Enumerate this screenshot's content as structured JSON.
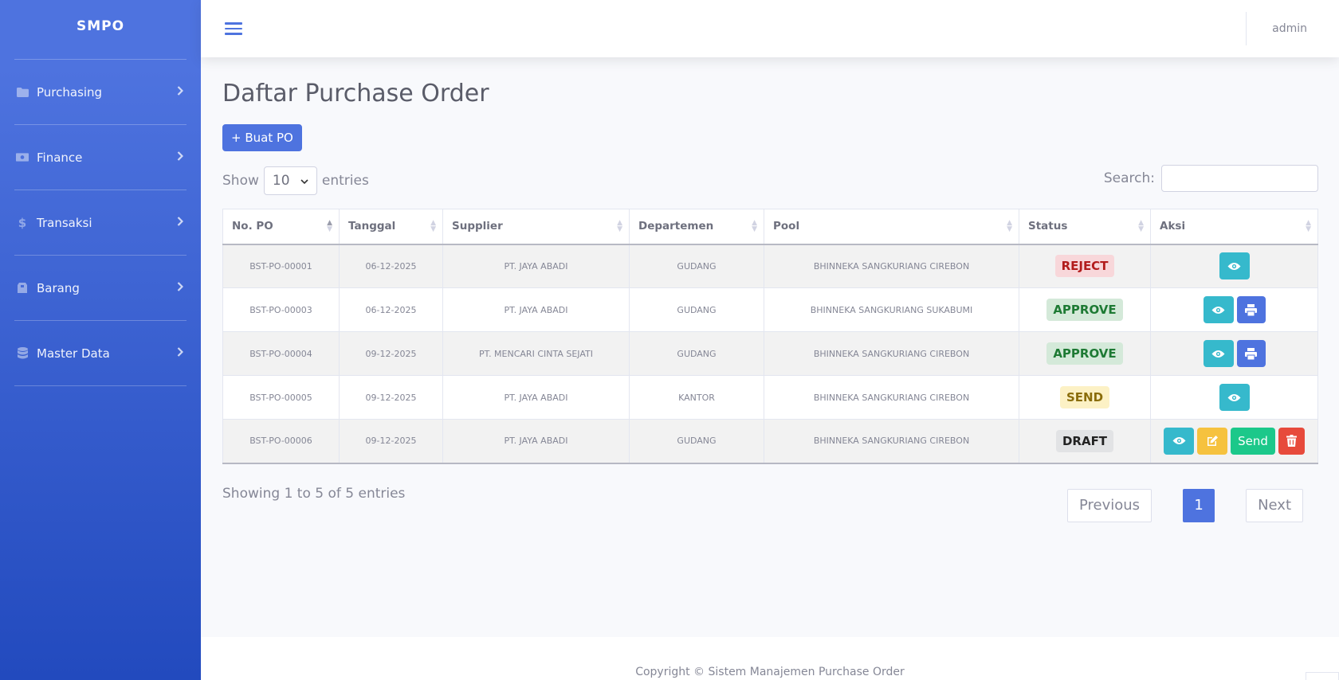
{
  "brand": "SMPO",
  "sidebar": {
    "items": [
      {
        "label": "Purchasing",
        "icon": "folder-icon"
      },
      {
        "label": "Finance",
        "icon": "money-bill-icon"
      },
      {
        "label": "Transaksi",
        "icon": "dollar-icon"
      },
      {
        "label": "Barang",
        "icon": "box-icon"
      },
      {
        "label": "Master Data",
        "icon": "database-icon"
      }
    ]
  },
  "topbar": {
    "user": "admin"
  },
  "main": {
    "title": "Daftar Purchase Order",
    "create_button": "+ Buat PO",
    "show_label": "Show",
    "entries_value": "10",
    "entries_label": "entries",
    "search_label": "Search:",
    "search_value": "",
    "table": {
      "headers": [
        "No. PO",
        "Tanggal",
        "Supplier",
        "Departemen",
        "Pool",
        "Status",
        "Aksi"
      ],
      "rows": [
        {
          "no": "BST-PO-00001",
          "tanggal": "06-12-2025",
          "supplier": "PT. JAYA ABADI",
          "departemen": "GUDANG",
          "pool": "BHINNEKA SANGKURIANG CIREBON",
          "status": "REJECT"
        },
        {
          "no": "BST-PO-00003",
          "tanggal": "06-12-2025",
          "supplier": "PT. JAYA ABADI",
          "departemen": "GUDANG",
          "pool": "BHINNEKA SANGKURIANG SUKABUMI",
          "status": "APPROVE"
        },
        {
          "no": "BST-PO-00004",
          "tanggal": "09-12-2025",
          "supplier": "PT. MENCARI CINTA SEJATI",
          "departemen": "GUDANG",
          "pool": "BHINNEKA SANGKURIANG CIREBON",
          "status": "APPROVE"
        },
        {
          "no": "BST-PO-00005",
          "tanggal": "09-12-2025",
          "supplier": "PT. JAYA ABADI",
          "departemen": "KANTOR",
          "pool": "BHINNEKA SANGKURIANG CIREBON",
          "status": "SEND"
        },
        {
          "no": "BST-PO-00006",
          "tanggal": "09-12-2025",
          "supplier": "PT. JAYA ABADI",
          "departemen": "GUDANG",
          "pool": "BHINNEKA SANGKURIANG CIREBON",
          "status": "DRAFT"
        }
      ],
      "send_label": "Send"
    },
    "info": "Showing 1 to 5 of 5 entries",
    "pagination": {
      "previous": "Previous",
      "page": "1",
      "next": "Next"
    }
  },
  "footer": "Copyright © Sistem Manajemen Purchase Order",
  "colors": {
    "primary": "#4e73df",
    "info": "#36b9cc",
    "warning": "#f6c23e",
    "success": "#1cc88a",
    "danger": "#e74a3b"
  }
}
